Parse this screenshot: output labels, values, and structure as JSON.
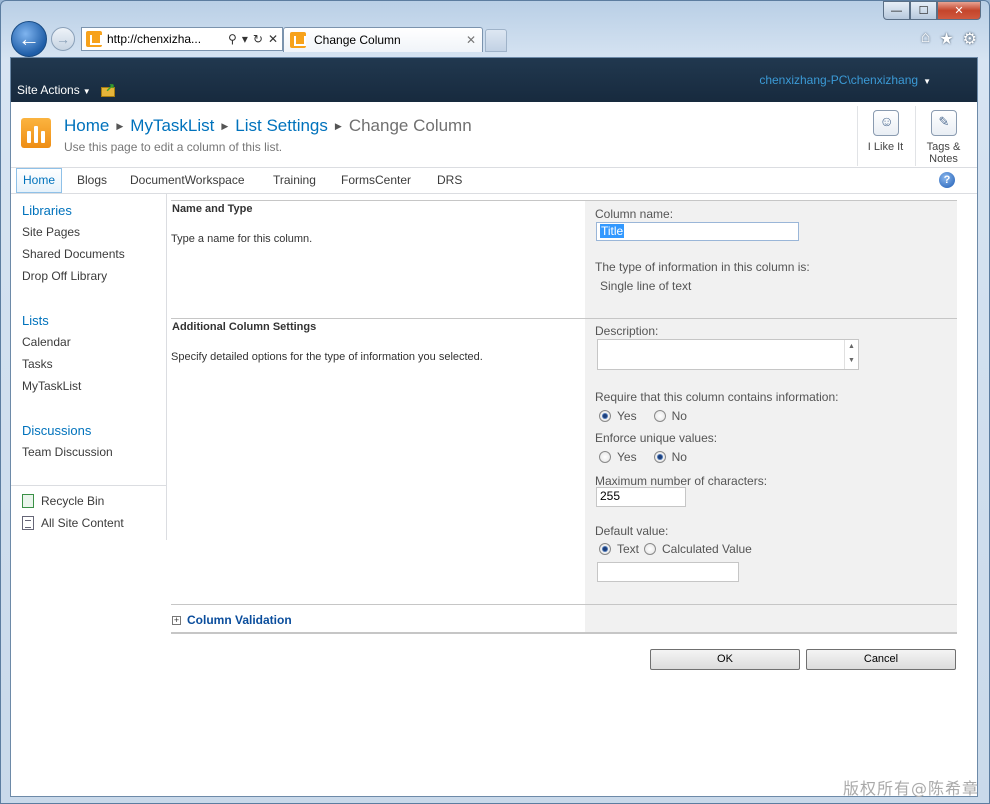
{
  "browser": {
    "address": "http://chenxizha...",
    "tab_title": "Change Column",
    "addr_icons": [
      "⚲",
      "▾",
      "↻",
      "✕"
    ],
    "tab_close": "✕",
    "win_controls": [
      "—",
      "☐",
      "✕"
    ],
    "toolbar_icons": [
      "⌂",
      "★",
      "⚙"
    ]
  },
  "ribbon": {
    "site_actions": "Site Actions",
    "user": "chenxizhang-PC\\chenxizhang"
  },
  "breadcrumb": {
    "home": "Home",
    "list": "MyTaskList",
    "settings": "List Settings",
    "current": "Change Column",
    "description": "Use this page to edit a column of this list."
  },
  "social": {
    "like": "I Like It",
    "tags_line1": "Tags &",
    "tags_line2": "Notes"
  },
  "topnav": [
    "Home",
    "Blogs",
    "DocumentWorkspace",
    "Training",
    "FormsCenter",
    "DRS"
  ],
  "quicklaunch": {
    "libraries": "Libraries",
    "library_items": [
      "Site Pages",
      "Shared Documents",
      "Drop Off Library"
    ],
    "lists": "Lists",
    "list_items": [
      "Calendar",
      "Tasks",
      "MyTaskList"
    ],
    "discussions": "Discussions",
    "discussion_items": [
      "Team Discussion"
    ],
    "recycle_bin": "Recycle Bin",
    "all_site_content": "All Site Content"
  },
  "form": {
    "name_type": {
      "title": "Name and Type",
      "description": "Type a name for this column.",
      "column_name_label": "Column name:",
      "column_name_value": "Title",
      "type_label": "The type of information in this column is:",
      "type_value": "Single line of text"
    },
    "additional": {
      "title": "Additional Column Settings",
      "description": "Specify detailed options for the type of information you selected.",
      "description_label": "Description:",
      "require_label": "Require that this column contains information:",
      "require_options": [
        "Yes",
        "No"
      ],
      "require_selected": "Yes",
      "unique_label": "Enforce unique values:",
      "unique_options": [
        "Yes",
        "No"
      ],
      "unique_selected": "No",
      "max_chars_label": "Maximum number of characters:",
      "max_chars_value": "255",
      "default_label": "Default value:",
      "default_options": [
        "Text",
        "Calculated Value"
      ],
      "default_selected": "Text",
      "default_value": ""
    },
    "validation": "Column Validation",
    "ok": "OK",
    "cancel": "Cancel"
  },
  "watermark": "版权所有@陈希章",
  "colors": {
    "ribbon_bg": "#172a3e",
    "link": "#0072bc",
    "user_link": "#3b9ad6",
    "section_bg": "#f1f1f1"
  }
}
